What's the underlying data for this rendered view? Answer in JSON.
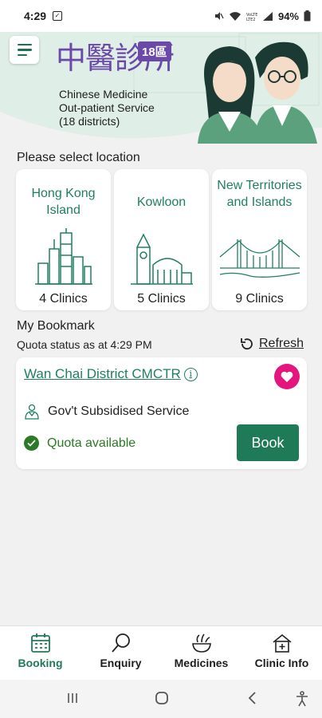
{
  "status_bar": {
    "time": "4:29",
    "battery": "94%"
  },
  "header": {
    "logo_cjk": "中醫診所",
    "logo_badge": "18區",
    "logo_lines": [
      "Chinese Medicine",
      "Out-patient Service",
      "(18 districts)"
    ]
  },
  "location": {
    "title": "Please select location",
    "cards": [
      {
        "name": "Hong Kong Island",
        "count": "4 Clinics"
      },
      {
        "name": "Kowloon",
        "count": "5 Clinics"
      },
      {
        "name": "New Territories and Islands",
        "count": "9 Clinics"
      }
    ]
  },
  "bookmark": {
    "title": "My Bookmark",
    "quota_status": "Quota status as at 4:29 PM",
    "refresh_label": "Refresh",
    "clinic": {
      "name": "Wan Chai District CMCTR",
      "service": "Gov't Subsidised Service",
      "quota": "Quota available",
      "book_label": "Book"
    }
  },
  "bottom_nav": {
    "items": [
      {
        "label": "Booking",
        "active": true
      },
      {
        "label": "Enquiry",
        "active": false
      },
      {
        "label": "Medicines",
        "active": false
      },
      {
        "label": "Clinic Info",
        "active": false
      }
    ]
  },
  "colors": {
    "accent": "#1f7a57",
    "link": "#1f8060",
    "heart": "#e5157e",
    "brand": "#6a49a8",
    "header_bg": "#dfeee6"
  }
}
